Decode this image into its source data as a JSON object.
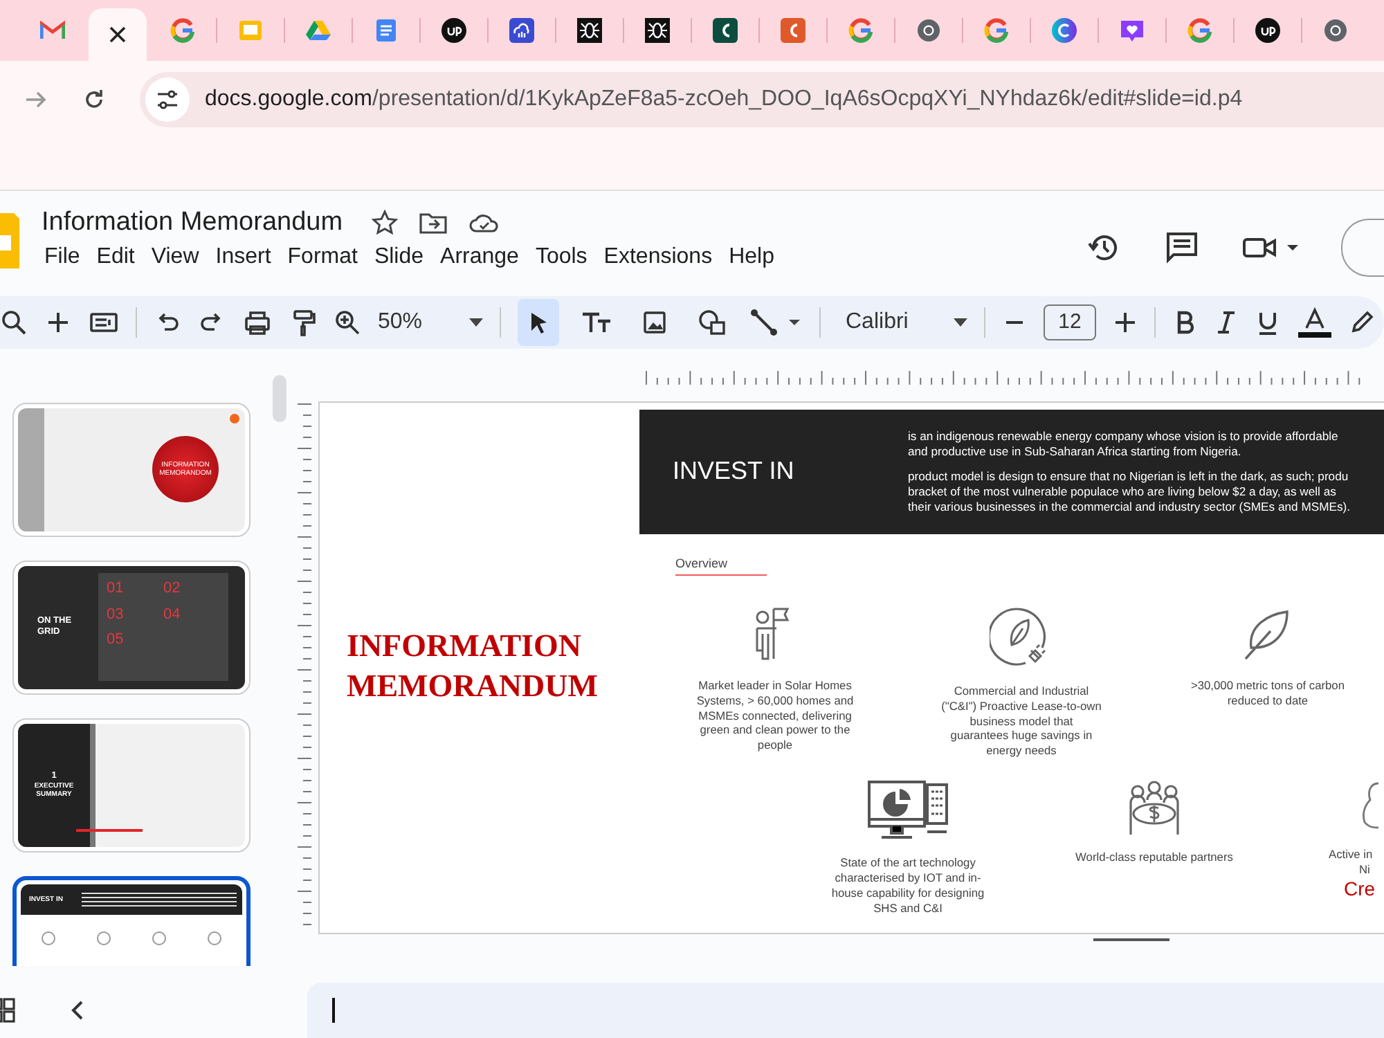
{
  "browser": {
    "tabs": [
      {
        "kind": "gmail",
        "selected": false
      },
      {
        "kind": "current",
        "selected": true
      },
      {
        "kind": "google",
        "selected": false
      },
      {
        "kind": "slides",
        "selected": false
      },
      {
        "kind": "drive",
        "selected": false
      },
      {
        "kind": "docs",
        "selected": false
      },
      {
        "kind": "dark-circle",
        "selected": false
      },
      {
        "kind": "cloud",
        "selected": false
      },
      {
        "kind": "bug",
        "selected": false
      },
      {
        "kind": "bug",
        "selected": false
      },
      {
        "kind": "c-green",
        "selected": false
      },
      {
        "kind": "c-orange",
        "selected": false
      },
      {
        "kind": "google",
        "selected": false
      },
      {
        "kind": "chrome",
        "selected": false
      },
      {
        "kind": "google",
        "selected": false
      },
      {
        "kind": "canva",
        "selected": false
      },
      {
        "kind": "heart",
        "selected": false
      },
      {
        "kind": "google",
        "selected": false
      },
      {
        "kind": "dark-circle",
        "selected": false
      },
      {
        "kind": "chrome",
        "selected": false
      }
    ],
    "url_host": "docs.google.com",
    "url_path": "/presentation/d/1KykApZeF8a5-zcOeh_DOO_IqA6sOcpqXYi_NYhdaz6k/edit#slide=id.p4"
  },
  "document": {
    "title": "Information Memorandum",
    "menu": [
      "File",
      "Edit",
      "View",
      "Insert",
      "Format",
      "Slide",
      "Arrange",
      "Tools",
      "Extensions",
      "Help"
    ]
  },
  "toolbar": {
    "zoom": "50%",
    "font": "Calibri",
    "font_size": "12",
    "tools": [
      {
        "kind": "select",
        "selected": true
      },
      {
        "kind": "text-box",
        "selected": false
      },
      {
        "kind": "image",
        "selected": false
      },
      {
        "kind": "shape",
        "selected": false
      },
      {
        "kind": "line",
        "selected": false
      }
    ]
  },
  "filmstrip": [
    {
      "kind": "cover",
      "selected": false,
      "texts": [
        "INFORMATION",
        "MEMORANDOM"
      ]
    },
    {
      "kind": "grid",
      "selected": false,
      "texts": [
        "ON THE",
        "GRID",
        "01",
        "02",
        "03",
        "04",
        "05"
      ]
    },
    {
      "kind": "section",
      "selected": false,
      "texts": [
        "1",
        "EXECUTIVE",
        "SUMMARY"
      ]
    },
    {
      "kind": "invest",
      "selected": true,
      "texts": [
        "INVEST IN"
      ]
    }
  ],
  "slide": {
    "title": "INFORMATION MEMORANDUM",
    "heading": "INVEST IN",
    "paragraphs": [
      [
        "is an indigenous renewable energy company whose vision is to provide affordable",
        "and productive use in Sub-Saharan Africa starting from Nigeria."
      ],
      [
        "product model is design to ensure that no Nigerian is left in the dark, as such; produ",
        "bracket of the most vulnerable populace who are living below $2 a day, as well as",
        "their various businesses in the commercial and industry sector  (SMEs and MSMEs)."
      ]
    ],
    "section": "Overview",
    "features": [
      {
        "kind": "person-flag",
        "text": "Market leader in Solar Homes Systems, > 60,000 homes and MSMEs connected, delivering green and clean power to the people"
      },
      {
        "kind": "leaf-plug",
        "text": "Commercial and Industrial (\"C&I\") Proactive Lease-to-own business model that guarantees huge savings in energy needs"
      },
      {
        "kind": "leaf",
        "text": ">30,000 metric tons of carbon reduced to date"
      },
      {
        "kind": "computer",
        "text": "State of the art technology characterised by IOT and in-house capability for designing SHS and C&I"
      },
      {
        "kind": "people-money",
        "text": "World-class reputable partners"
      },
      {
        "kind": "map",
        "text": "Active in",
        "text_2": "Ni",
        "accent": "Cre"
      }
    ]
  }
}
